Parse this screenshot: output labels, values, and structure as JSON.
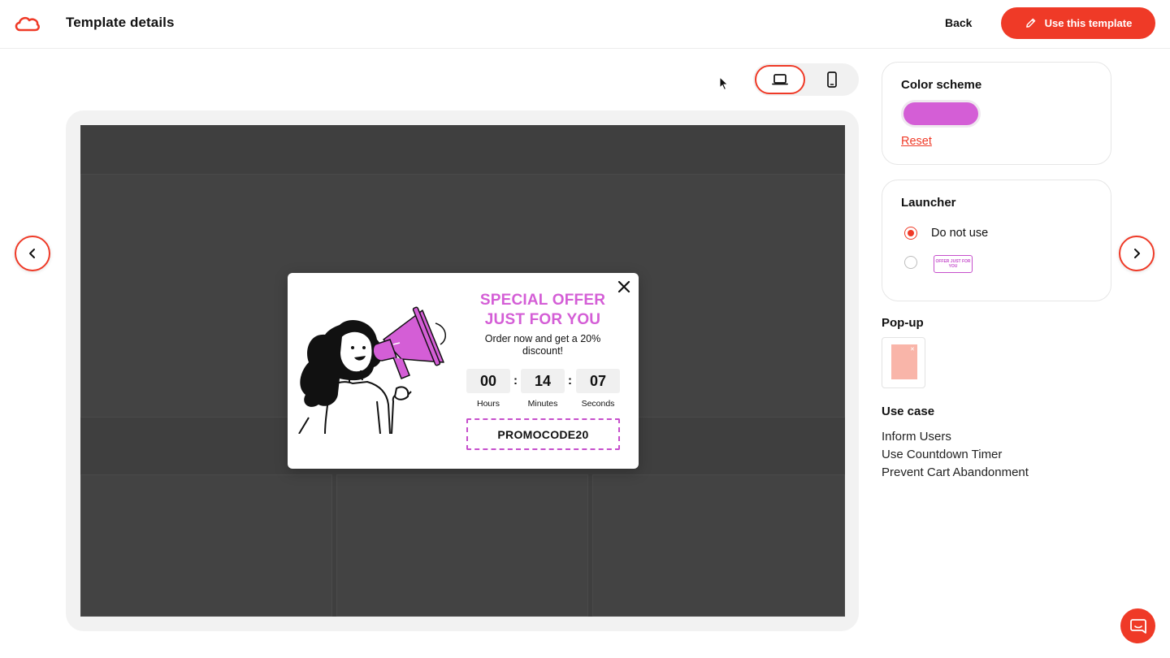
{
  "header": {
    "title": "Template details",
    "back_label": "Back",
    "use_template_label": "Use this template"
  },
  "preview": {
    "popup": {
      "headline_line1": "SPECIAL OFFER",
      "headline_line2": "JUST FOR YOU",
      "subtext": "Order now and get a 20% discount!",
      "timer": {
        "hours": "00",
        "minutes": "14",
        "seconds": "07",
        "separator": ":",
        "hours_label": "Hours",
        "minutes_label": "Minutes",
        "seconds_label": "Seconds"
      },
      "promo_code": "PROMOCODE20"
    }
  },
  "sidebar": {
    "color_scheme": {
      "title": "Color scheme",
      "selected_color": "#d45ed6",
      "reset_label": "Reset"
    },
    "launcher": {
      "title": "Launcher",
      "options": [
        {
          "label": "Do not use",
          "checked": true
        },
        {
          "badge_text": "OFFER JUST FOR YOU",
          "checked": false
        }
      ]
    },
    "popup_section": {
      "title": "Pop-up"
    },
    "use_case": {
      "title": "Use case",
      "items": [
        "Inform Users",
        "Use Countdown Timer",
        "Prevent Cart Abandonment"
      ]
    }
  },
  "colors": {
    "accent": "#ef3a27",
    "popup_brand": "#d45ed6"
  },
  "icons": {
    "logo": "cloud-logo-icon",
    "use_template": "pencil-icon",
    "desktop": "laptop-icon",
    "mobile": "smartphone-icon",
    "prev": "chevron-left-icon",
    "next": "chevron-right-icon",
    "close": "close-icon",
    "chat": "chat-icon"
  }
}
